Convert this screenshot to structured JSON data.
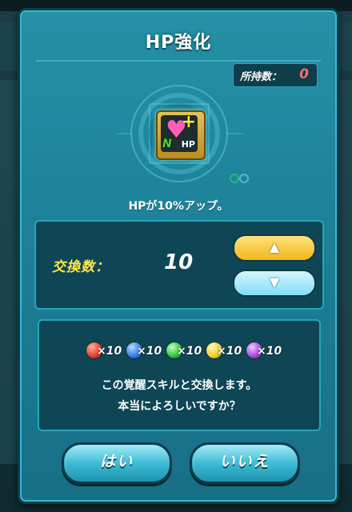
{
  "dialog": {
    "title": "HP強化",
    "owned_label": "所持数：",
    "owned_value": "0",
    "skill_icon": {
      "name": "heart-plus-icon",
      "rank": "N",
      "tag": "HP"
    },
    "description": "HPが10%アップ。",
    "exchange": {
      "label": "交換数：",
      "value": "10",
      "up_icon": "triangle-up-icon",
      "down_icon": "triangle-down-icon"
    },
    "orbs": [
      {
        "color": "#e23b2a",
        "count": "×10"
      },
      {
        "color": "#2f7ae8",
        "count": "×10"
      },
      {
        "color": "#2bc23b",
        "count": "×10"
      },
      {
        "color": "#f0d128",
        "count": "×10"
      },
      {
        "color": "#a54ad8",
        "count": "×10"
      }
    ],
    "confirm_line1": "この覚醒スキルと交換します。",
    "confirm_line2": "本当によろしいですか？",
    "yes_label": "はい",
    "no_label": "いいえ"
  },
  "colors": {
    "accent": "#ffe74a",
    "owned_value": "#ff6b73",
    "dialog_bg": "#1b7f97"
  }
}
